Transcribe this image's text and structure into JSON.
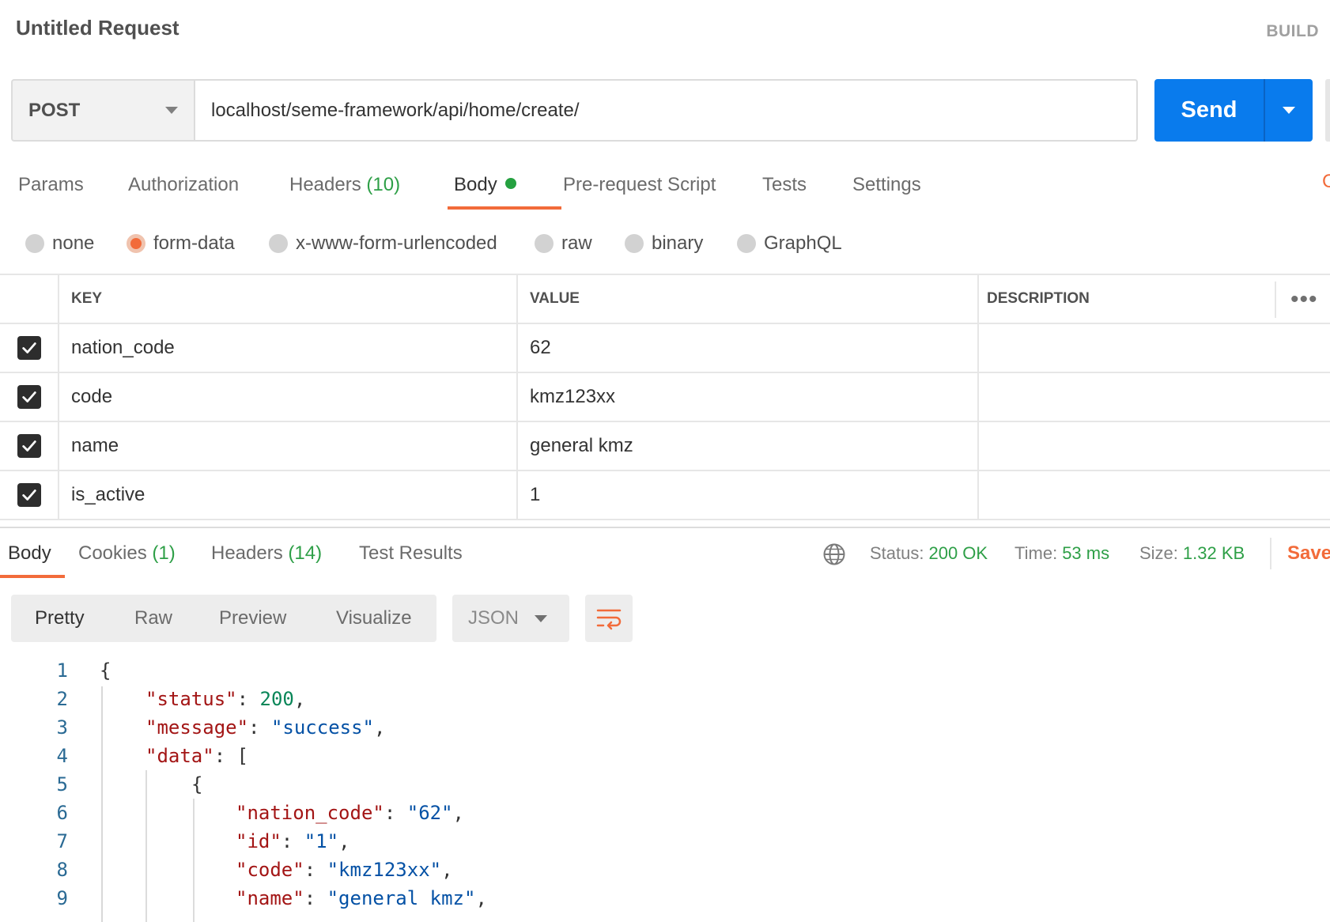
{
  "header": {
    "title": "Untitled Request",
    "build_label": "BUILD"
  },
  "request": {
    "method": "POST",
    "url": "localhost/seme-framework/api/home/create/",
    "send_label": "Send"
  },
  "request_tabs": {
    "params": "Params",
    "authorization": "Authorization",
    "headers": "Headers",
    "headers_count": "(10)",
    "body": "Body",
    "pre_request": "Pre-request Script",
    "tests": "Tests",
    "settings": "Settings",
    "right_partial": "C"
  },
  "body_types": {
    "none": "none",
    "form_data": "form-data",
    "urlencoded": "x-www-form-urlencoded",
    "raw": "raw",
    "binary": "binary",
    "graphql": "GraphQL",
    "selected": "form-data"
  },
  "params_table": {
    "headers": {
      "key": "KEY",
      "value": "VALUE",
      "description": "DESCRIPTION",
      "more": "•••"
    },
    "rows": [
      {
        "key": "nation_code",
        "value": "62",
        "description": "",
        "checked": true
      },
      {
        "key": "code",
        "value": "kmz123xx",
        "description": "",
        "checked": true
      },
      {
        "key": "name",
        "value": "general kmz",
        "description": "",
        "checked": true
      },
      {
        "key": "is_active",
        "value": "1",
        "description": "",
        "checked": true
      }
    ]
  },
  "response_tabs": {
    "body": "Body",
    "cookies": "Cookies",
    "cookies_count": "(1)",
    "headers": "Headers",
    "headers_count": "(14)",
    "test_results": "Test Results"
  },
  "response_meta": {
    "status_label": "Status:",
    "status_value": "200 OK",
    "time_label": "Time:",
    "time_value": "53 ms",
    "size_label": "Size:",
    "size_value": "1.32 KB",
    "save_label": "Save"
  },
  "view_modes": {
    "pretty": "Pretty",
    "raw": "Raw",
    "preview": "Preview",
    "visualize": "Visualize",
    "format": "JSON",
    "active": "Pretty"
  },
  "code": {
    "line_numbers": [
      "1",
      "2",
      "3",
      "4",
      "5",
      "6",
      "7",
      "8",
      "9"
    ],
    "l1_open": "{",
    "l2_key": "\"status\"",
    "l2_sep": ": ",
    "l2_val": "200",
    "l2_end": ",",
    "l3_key": "\"message\"",
    "l3_sep": ": ",
    "l3_val": "\"success\"",
    "l3_end": ",",
    "l4_key": "\"data\"",
    "l4_sep": ": [",
    "l5_open": "{",
    "l6_key": "\"nation_code\"",
    "l6_sep": ": ",
    "l6_val": "\"62\"",
    "l6_end": ",",
    "l7_key": "\"id\"",
    "l7_sep": ": ",
    "l7_val": "\"1\"",
    "l7_end": ",",
    "l8_key": "\"code\"",
    "l8_sep": ": ",
    "l8_val": "\"kmz123xx\"",
    "l8_end": ",",
    "l9_key": "\"name\"",
    "l9_sep": ": ",
    "l9_val": "\"general kmz\"",
    "l9_end": ","
  },
  "colors": {
    "accent": "#f26b3a",
    "send": "#097bed",
    "success": "#2e9f47",
    "json_key": "#a31515",
    "json_string": "#0451a5",
    "json_number": "#098658"
  },
  "icons": {
    "method_dropdown": "chevron-down-icon",
    "send_dropdown": "chevron-down-icon",
    "globe": "globe-icon",
    "wrap": "wrap-lines-icon",
    "checkbox": "checkmark-icon"
  }
}
